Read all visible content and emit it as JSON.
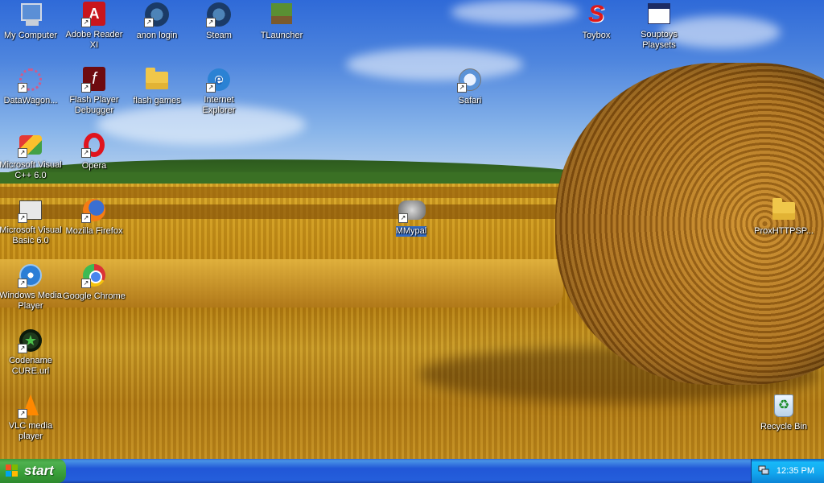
{
  "desktop": {
    "icons": [
      {
        "id": "my-computer",
        "label": "My Computer",
        "glyph": "computer-icon"
      },
      {
        "id": "adobe-reader",
        "label": "Adobe Reader XI",
        "glyph": "pdf-icon"
      },
      {
        "id": "anon-login",
        "label": "anon login",
        "glyph": "steam-icon"
      },
      {
        "id": "steam",
        "label": "Steam",
        "glyph": "steam-icon"
      },
      {
        "id": "tlauncher",
        "label": "TLauncher",
        "glyph": "minecraft-block-icon"
      },
      {
        "id": "toybox",
        "label": "Toybox",
        "glyph": "toybox-icon"
      },
      {
        "id": "souptoys",
        "label": "Souptoys Playsets",
        "glyph": "window-icon"
      },
      {
        "id": "datawagon",
        "label": "DataWagon...",
        "glyph": "datawagon-icon"
      },
      {
        "id": "flash-debugger",
        "label": "Flash Player Debugger",
        "glyph": "flash-icon"
      },
      {
        "id": "flash-games",
        "label": "flash games",
        "glyph": "folder-icon"
      },
      {
        "id": "internet-explorer",
        "label": "Internet Explorer",
        "glyph": "ie-icon"
      },
      {
        "id": "safari",
        "label": "Safari",
        "glyph": "safari-icon"
      },
      {
        "id": "visual-cpp",
        "label": "Microsoft Visual C++ 6.0",
        "glyph": "visual-cpp-icon"
      },
      {
        "id": "opera",
        "label": "Opera",
        "glyph": "opera-icon"
      },
      {
        "id": "visual-basic",
        "label": "Microsoft Visual Basic 6.0",
        "glyph": "visual-basic-icon"
      },
      {
        "id": "firefox",
        "label": "Mozilla Firefox",
        "glyph": "firefox-icon"
      },
      {
        "id": "mmypal",
        "label": "MMypal",
        "glyph": "mmypal-icon",
        "selected": true
      },
      {
        "id": "proxhttpsp",
        "label": "ProxHTTPSP...",
        "glyph": "folder-icon"
      },
      {
        "id": "wmp",
        "label": "Windows Media Player",
        "glyph": "media-player-icon"
      },
      {
        "id": "chrome",
        "label": "Google Chrome",
        "glyph": "chrome-icon"
      },
      {
        "id": "codename-cure",
        "label": "Codename CURE.url",
        "glyph": "cure-icon"
      },
      {
        "id": "vlc",
        "label": "VLC media player",
        "glyph": "vlc-icon"
      },
      {
        "id": "recycle-bin",
        "label": "Recycle Bin",
        "glyph": "recycle-bin-icon"
      }
    ]
  },
  "taskbar": {
    "start_label": "start",
    "clock": "12:35 PM",
    "tray_icon": "network-icon"
  },
  "colors": {
    "taskbar_blue": "#245edb",
    "start_green": "#3c9a3c",
    "tray_blue": "#12a6ee",
    "selection_blue": "#316ac5"
  }
}
